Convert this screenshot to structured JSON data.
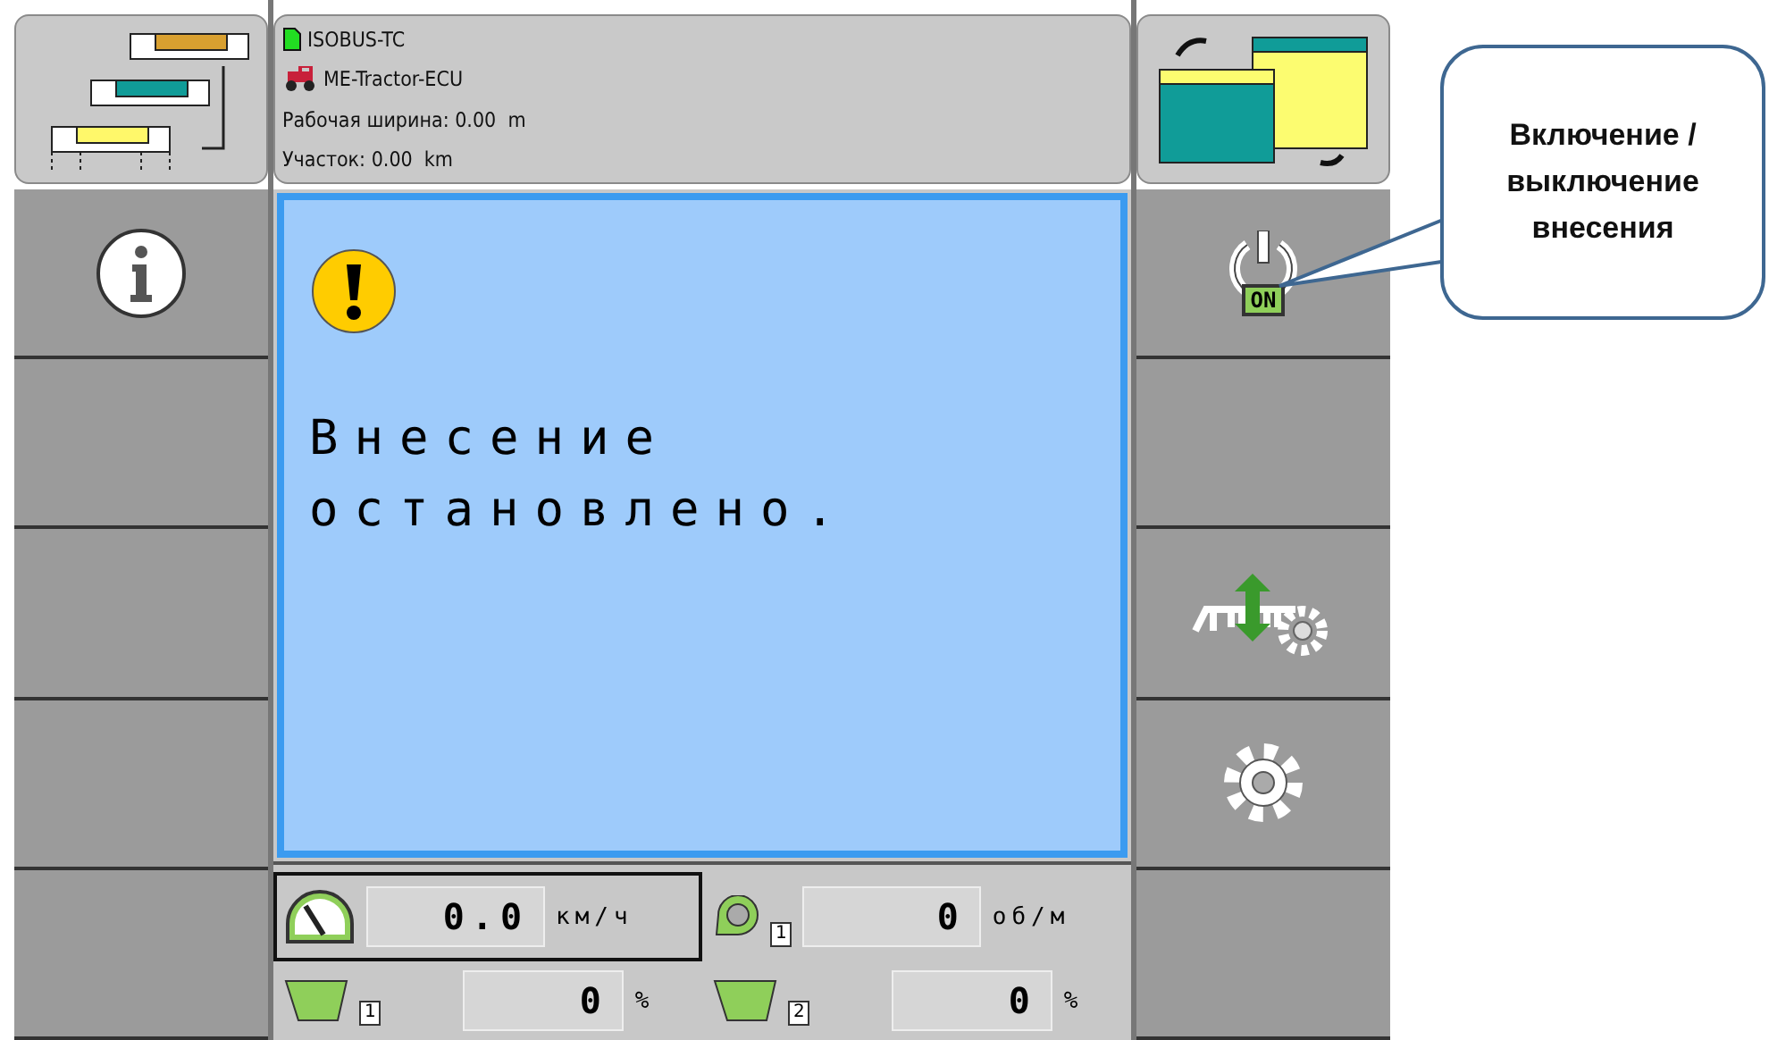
{
  "header": {
    "lines": [
      {
        "kind": "file",
        "text": "ISOBUS-TC"
      },
      {
        "kind": "tractor",
        "text": "ME-Tractor-ECU"
      },
      {
        "kind": "plain",
        "text": "Рабочая ширина: 0.00  m"
      },
      {
        "kind": "plain",
        "text": "Участок: 0.00  km"
      }
    ]
  },
  "left_softkeys": [
    {
      "kind": "info"
    },
    {
      "kind": "empty"
    },
    {
      "kind": "empty"
    },
    {
      "kind": "empty"
    },
    {
      "kind": "empty"
    }
  ],
  "right_softkeys": [
    {
      "kind": "power",
      "badge": "ON"
    },
    {
      "kind": "empty"
    },
    {
      "kind": "boom"
    },
    {
      "kind": "settings"
    },
    {
      "kind": "empty"
    }
  ],
  "dialog": {
    "message": "Внесение остановлено."
  },
  "readouts": [
    {
      "kind": "speed",
      "value": "0.0",
      "unit": "км/ч",
      "selected": true
    },
    {
      "kind": "rpm",
      "value": "0",
      "unit": "об/м",
      "badge": "1",
      "selected": false
    },
    {
      "kind": "hopper",
      "value": "0",
      "unit": "%",
      "badge": "1",
      "selected": false
    },
    {
      "kind": "hopper",
      "value": "0",
      "unit": "%",
      "badge": "2",
      "selected": false
    }
  ],
  "callout": {
    "text": "Включение / выключение внесения"
  }
}
